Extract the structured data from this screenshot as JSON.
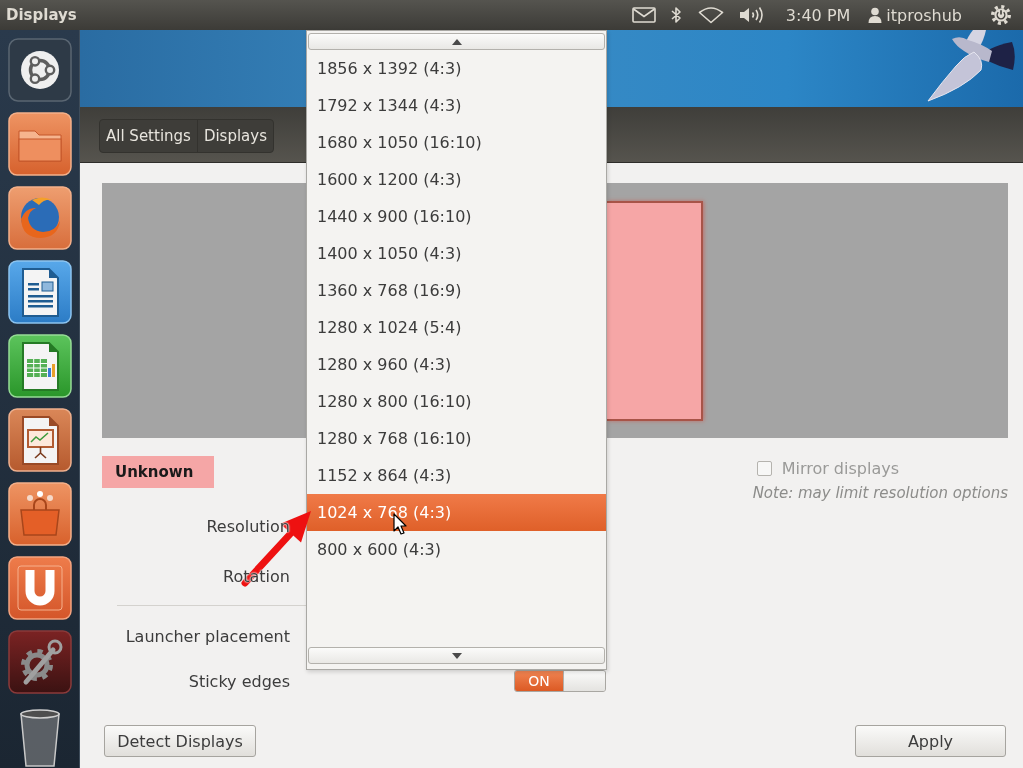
{
  "top_panel": {
    "title": "Displays",
    "clock": "3:40 PM",
    "user": "itproshub"
  },
  "launcher": [
    {
      "kind": "dash"
    },
    {
      "kind": "files"
    },
    {
      "kind": "browser"
    },
    {
      "kind": "writer"
    },
    {
      "kind": "calc"
    },
    {
      "kind": "impress"
    },
    {
      "kind": "software"
    },
    {
      "kind": "updater"
    },
    {
      "kind": "settings"
    },
    {
      "kind": "trash"
    }
  ],
  "breadcrumb": [
    {
      "label": "All Settings"
    },
    {
      "label": "Displays"
    }
  ],
  "display": {
    "name": "Unknown"
  },
  "mirror_displays": {
    "label": "Mirror displays",
    "checked": false,
    "disabled": true,
    "note": "Note: may limit resolution options"
  },
  "display_settings": [
    {
      "label": "Resolution"
    },
    {
      "label": "Rotation"
    }
  ],
  "launcher_settings": [
    {
      "label": "Launcher placement"
    },
    {
      "label": "Sticky edges",
      "switch": {
        "on": true,
        "text": "ON"
      }
    }
  ],
  "resolution_menu": [
    {
      "label": "1856 x 1392 (4:3)",
      "selected": false
    },
    {
      "label": "1792 x 1344 (4:3)",
      "selected": false
    },
    {
      "label": "1680 x 1050 (16:10)",
      "selected": false
    },
    {
      "label": "1600 x 1200 (4:3)",
      "selected": false
    },
    {
      "label": "1440 x 900 (16:10)",
      "selected": false
    },
    {
      "label": "1400 x 1050 (4:3)",
      "selected": false
    },
    {
      "label": "1360 x 768 (16:9)",
      "selected": false
    },
    {
      "label": "1280 x 1024 (5:4)",
      "selected": false
    },
    {
      "label": "1280 x 960 (4:3)",
      "selected": false
    },
    {
      "label": "1280 x 800 (16:10)",
      "selected": false
    },
    {
      "label": "1280 x 768 (16:10)",
      "selected": false
    },
    {
      "label": "1152 x 864 (4:3)",
      "selected": false
    },
    {
      "label": "1024 x 768 (4:3)",
      "selected": true
    },
    {
      "label": "800 x 600 (4:3)",
      "selected": false
    }
  ],
  "detect_button": "Detect Displays",
  "apply_button": "Apply"
}
